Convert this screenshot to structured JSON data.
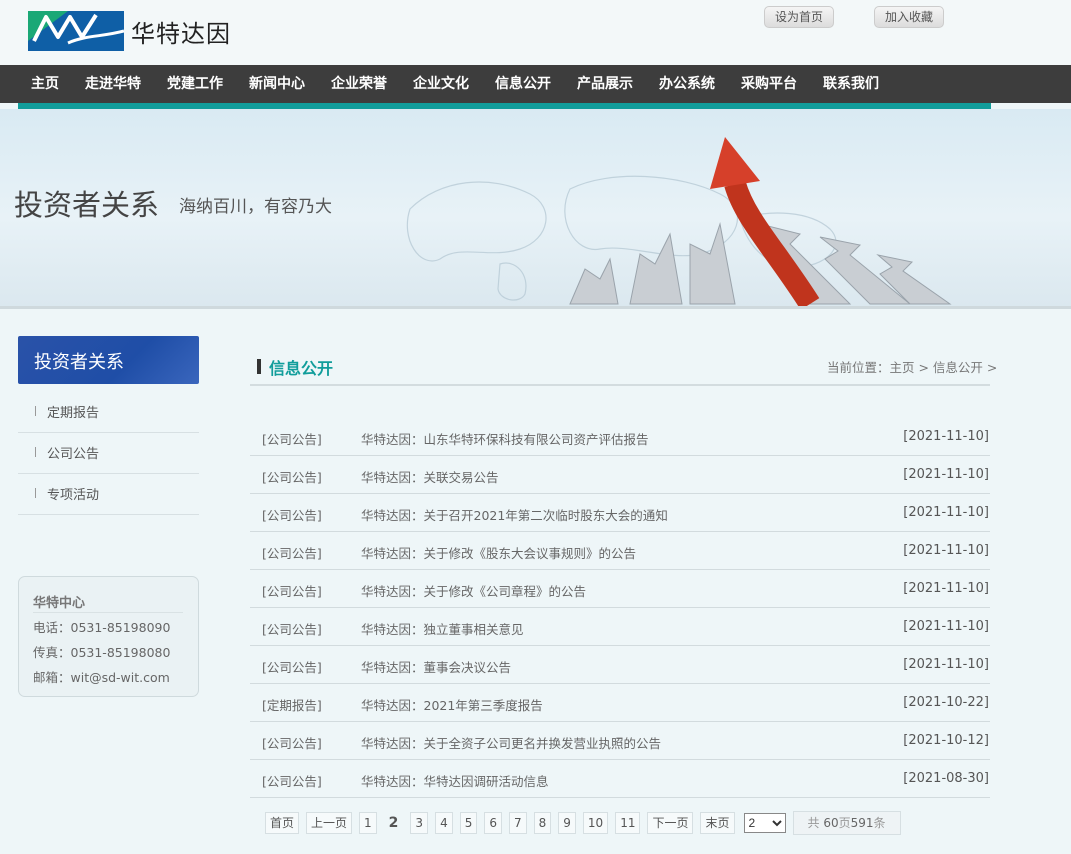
{
  "header": {
    "logo_text": "华特达因",
    "set_home": "设为首页",
    "add_fav": "加入收藏"
  },
  "nav": [
    "主页",
    "走进华特",
    "党建工作",
    "新闻中心",
    "企业荣誉",
    "企业文化",
    "信息公开",
    "产品展示",
    "办公系统",
    "采购平台",
    "联系我们"
  ],
  "banner": {
    "title": "投资者关系",
    "subtitle": "海纳百川，有容乃大"
  },
  "sidebar": {
    "heading": "投资者关系",
    "items": [
      "定期报告",
      "公司公告",
      "专项活动"
    ],
    "contact": {
      "title": "华特中心",
      "phone": "电话：0531-85198090",
      "fax": "传真：0531-85198080",
      "email": "邮箱：wit@sd-wit.com"
    }
  },
  "main": {
    "title": "信息公开",
    "breadcrumb": "当前位置：主页 > 信息公开 >",
    "rows": [
      {
        "cat": "[公司公告]",
        "title": "华特达因：山东华特环保科技有限公司资产评估报告",
        "date": "[2021-11-10]"
      },
      {
        "cat": "[公司公告]",
        "title": "华特达因：关联交易公告",
        "date": "[2021-11-10]"
      },
      {
        "cat": "[公司公告]",
        "title": "华特达因：关于召开2021年第二次临时股东大会的通知",
        "date": "[2021-11-10]"
      },
      {
        "cat": "[公司公告]",
        "title": "华特达因：关于修改《股东大会议事规则》的公告",
        "date": "[2021-11-10]"
      },
      {
        "cat": "[公司公告]",
        "title": "华特达因：关于修改《公司章程》的公告",
        "date": "[2021-11-10]"
      },
      {
        "cat": "[公司公告]",
        "title": "华特达因：独立董事相关意见",
        "date": "[2021-11-10]"
      },
      {
        "cat": "[公司公告]",
        "title": "华特达因：董事会决议公告",
        "date": "[2021-11-10]"
      },
      {
        "cat": "[定期报告]",
        "title": "华特达因：2021年第三季度报告",
        "date": "[2021-10-22]"
      },
      {
        "cat": "[公司公告]",
        "title": "华特达因：关于全资子公司更名并换发营业执照的公告",
        "date": "[2021-10-12]"
      },
      {
        "cat": "[公司公告]",
        "title": "华特达因：华特达因调研活动信息",
        "date": "[2021-08-30]"
      }
    ]
  },
  "pager": {
    "first": "首页",
    "prev": "上一页",
    "pages": [
      "1",
      "2",
      "3",
      "4",
      "5",
      "6",
      "7",
      "8",
      "9",
      "10",
      "11"
    ],
    "current": "2",
    "next": "下一页",
    "last": "末页",
    "select_value": "2",
    "info_prefix": "共",
    "total_pages": "60",
    "info_mid": "页",
    "total_items": "591",
    "info_suffix": "条"
  }
}
